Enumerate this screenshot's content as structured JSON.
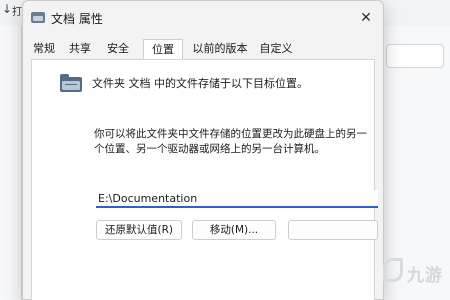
{
  "background": {
    "back_arrow": "↓",
    "glyph": "打"
  },
  "dialog": {
    "title": "文档 属性",
    "close_label": "✕",
    "tabs": [
      {
        "label": "常规",
        "active": false
      },
      {
        "label": "共享",
        "active": false
      },
      {
        "label": "安全",
        "active": false
      },
      {
        "label": "位置",
        "active": true
      },
      {
        "label": "以前的版本",
        "active": false
      },
      {
        "label": "自定义",
        "active": false
      }
    ],
    "heading": "文件夹 文档 中的文件存储于以下目标位置。",
    "description": "你可以将此文件夹中文件存储的位置更改为此硬盘上的另一个位置、另一个驱动器或网络上的另一台计算机。",
    "path_value": "E:\\Documentation",
    "buttons": {
      "restore": "还原默认值(R)",
      "move": "移动(M)...",
      "third": ""
    }
  },
  "watermark": {
    "text": "九游"
  },
  "colors": {
    "accent": "#2a62c9",
    "folder": "#566c86"
  }
}
